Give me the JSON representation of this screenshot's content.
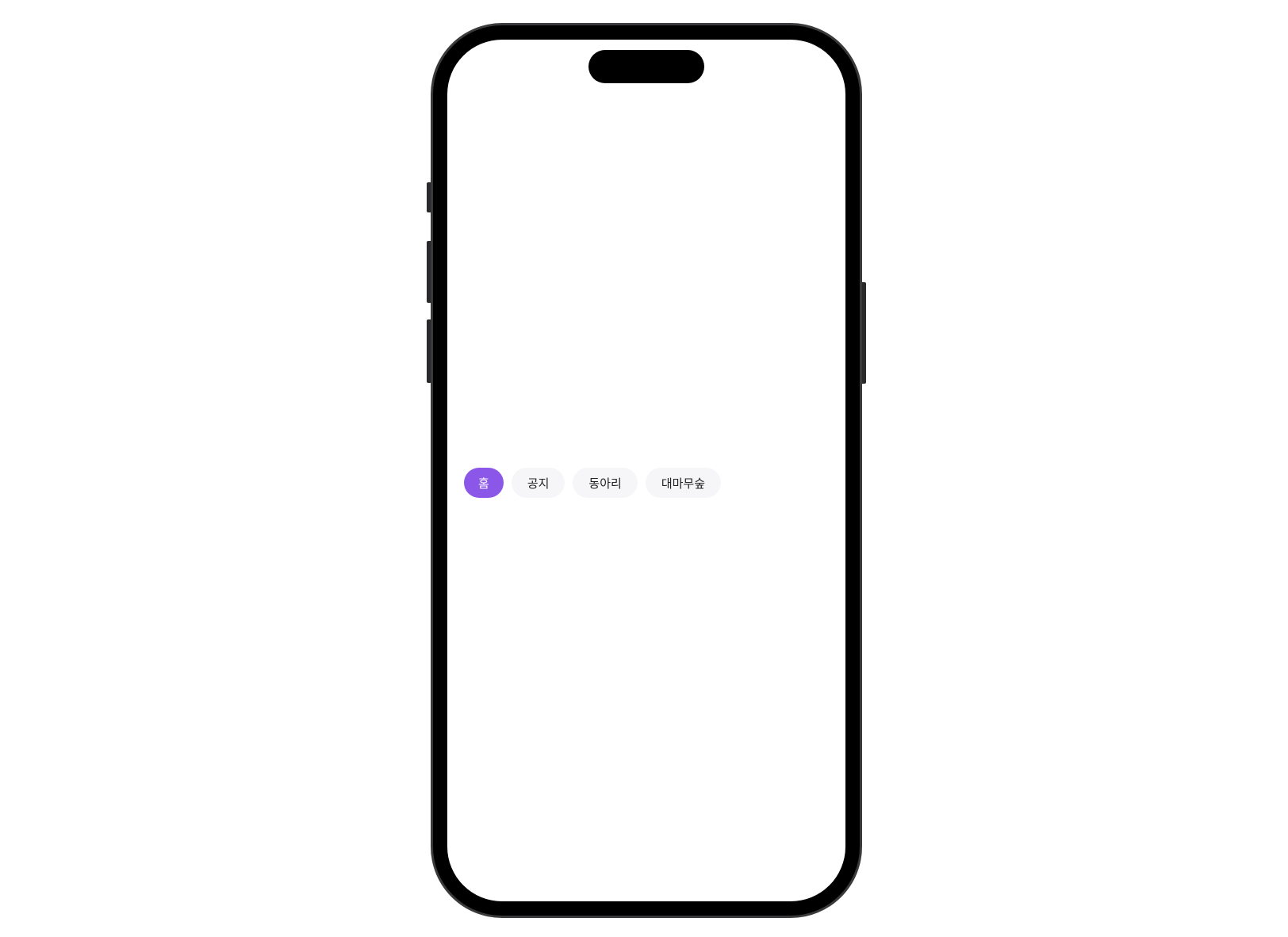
{
  "tabs": [
    {
      "label": "홈",
      "active": true
    },
    {
      "label": "공지",
      "active": false
    },
    {
      "label": "동아리",
      "active": false
    },
    {
      "label": "대마무숲",
      "active": false
    }
  ],
  "colors": {
    "accent": "#8b57e9",
    "chip_background": "#f6f5f8",
    "chip_text": "#222222",
    "active_text": "#ffffff",
    "frame": "#000000"
  }
}
